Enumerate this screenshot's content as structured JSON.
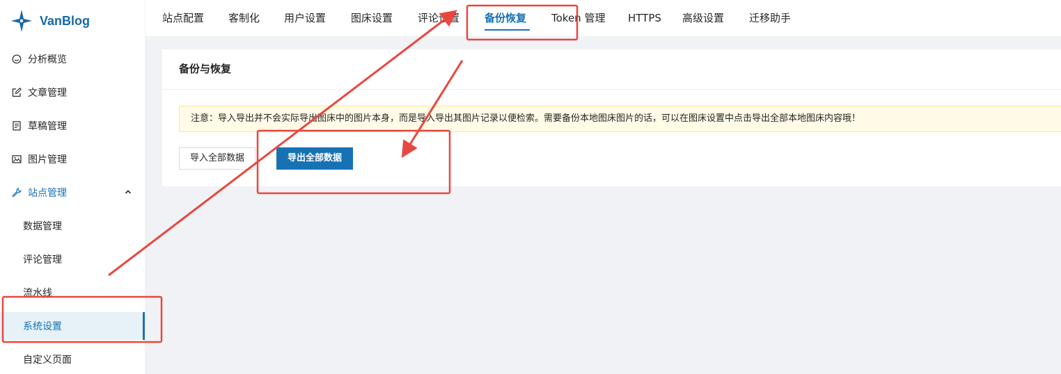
{
  "brand": {
    "name": "VanBlog"
  },
  "sidebar": {
    "menu": [
      {
        "label": "分析概览",
        "icon": "dashboard-icon"
      },
      {
        "label": "文章管理",
        "icon": "edit-icon"
      },
      {
        "label": "草稿管理",
        "icon": "draft-icon"
      },
      {
        "label": "图片管理",
        "icon": "picture-icon"
      },
      {
        "label": "站点管理",
        "icon": "tool-icon",
        "expanded": true
      }
    ],
    "submenu": [
      {
        "label": "数据管理"
      },
      {
        "label": "评论管理"
      },
      {
        "label": "流水线"
      },
      {
        "label": "系统设置",
        "selected": true
      },
      {
        "label": "自定义页面"
      }
    ]
  },
  "tabs": [
    {
      "label": "站点配置"
    },
    {
      "label": "客制化"
    },
    {
      "label": "用户设置"
    },
    {
      "label": "图床设置"
    },
    {
      "label": "评论设置"
    },
    {
      "label": "备份恢复",
      "active": true
    },
    {
      "label": "Token 管理"
    },
    {
      "label": "HTTPS"
    },
    {
      "label": "高级设置"
    },
    {
      "label": "迁移助手"
    }
  ],
  "card": {
    "title": "备份与恢复",
    "alert": "注意：导入导出并不会实际导出图床中的图片本身，而是导入导出其图片记录以便检索。需要备份本地图床图片的话，可以在图床设置中点击导出全部本地图床内容哦！",
    "import_button": "导入全部数据",
    "export_button": "导出全部数据"
  },
  "colors": {
    "accent": "#1772b4",
    "annotation": "#e8473f",
    "alert_bg": "#fffbe6",
    "alert_border": "#ffe58f"
  }
}
